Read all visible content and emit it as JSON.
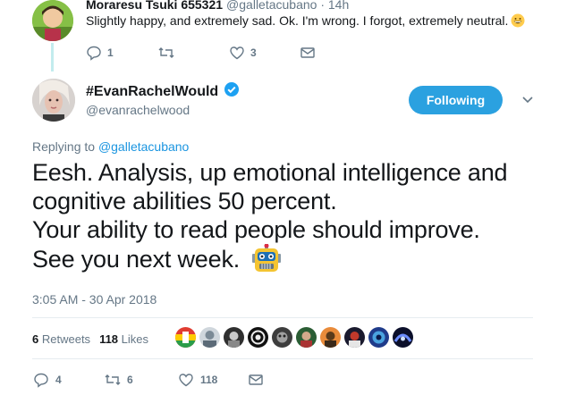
{
  "top_tweet": {
    "name": "Moraresu Tsuki 655321",
    "handle": "@galletacubano · 14h",
    "text": "Slightly happy, and extremely sad. Ok. I'm wrong. I forgot, extremely neutral.",
    "reply_count": "1",
    "retweet_count": "",
    "like_count": "3"
  },
  "main_tweet": {
    "name": "#EvanRachelWould",
    "handle": "@evanrachelwood",
    "follow_label": "Following",
    "replying_prefix": "Replying to",
    "replying_to": "@galletacubano",
    "lines": [
      "Eesh. Analysis, up emotional intelligence and",
      "cognitive abilities 50 percent.",
      "Your ability to read people should improve.",
      "See you next week."
    ],
    "timestamp": "3:05 AM - 30 Apr 2018",
    "retweets_num": "6",
    "retweets_label": "Retweets",
    "likes_num": "118",
    "likes_label": "Likes",
    "reply_count": "4",
    "retweet_count": "6",
    "like_count": "118"
  },
  "colors": {
    "accent": "#1b95e0",
    "muted": "#657786",
    "thread_line": "#c3ecee"
  }
}
